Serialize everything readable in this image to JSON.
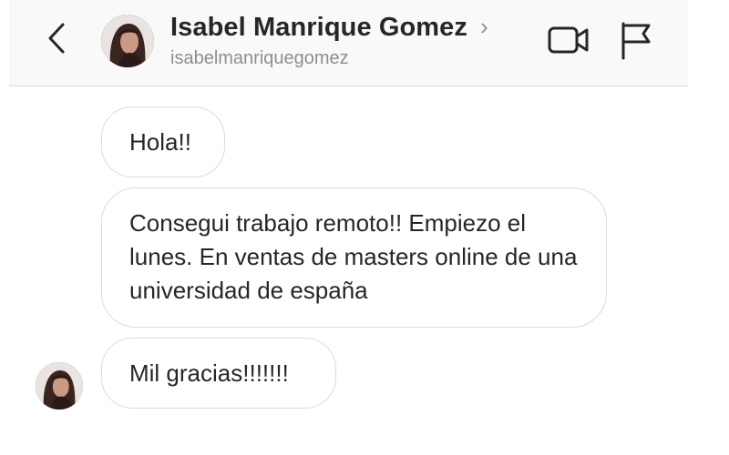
{
  "header": {
    "name": "Isabel Manrique Gomez",
    "username": "isabelmanriquegomez",
    "chevron": "›"
  },
  "icons": {
    "back": "chevron-left-icon",
    "video": "video-camera-icon",
    "flag": "flag-icon"
  },
  "messages": [
    {
      "text": "Hola!!"
    },
    {
      "text": "Consegui trabajo remoto!! Empiezo el lunes. En ventas de masters online de una universidad de españa"
    },
    {
      "text": "Mil gracias!!!!!!!"
    }
  ],
  "colors": {
    "text": "#262626",
    "muted": "#8e8e8e",
    "bubble_border": "#dbdbdb",
    "header_bg": "#f9f9f9"
  }
}
